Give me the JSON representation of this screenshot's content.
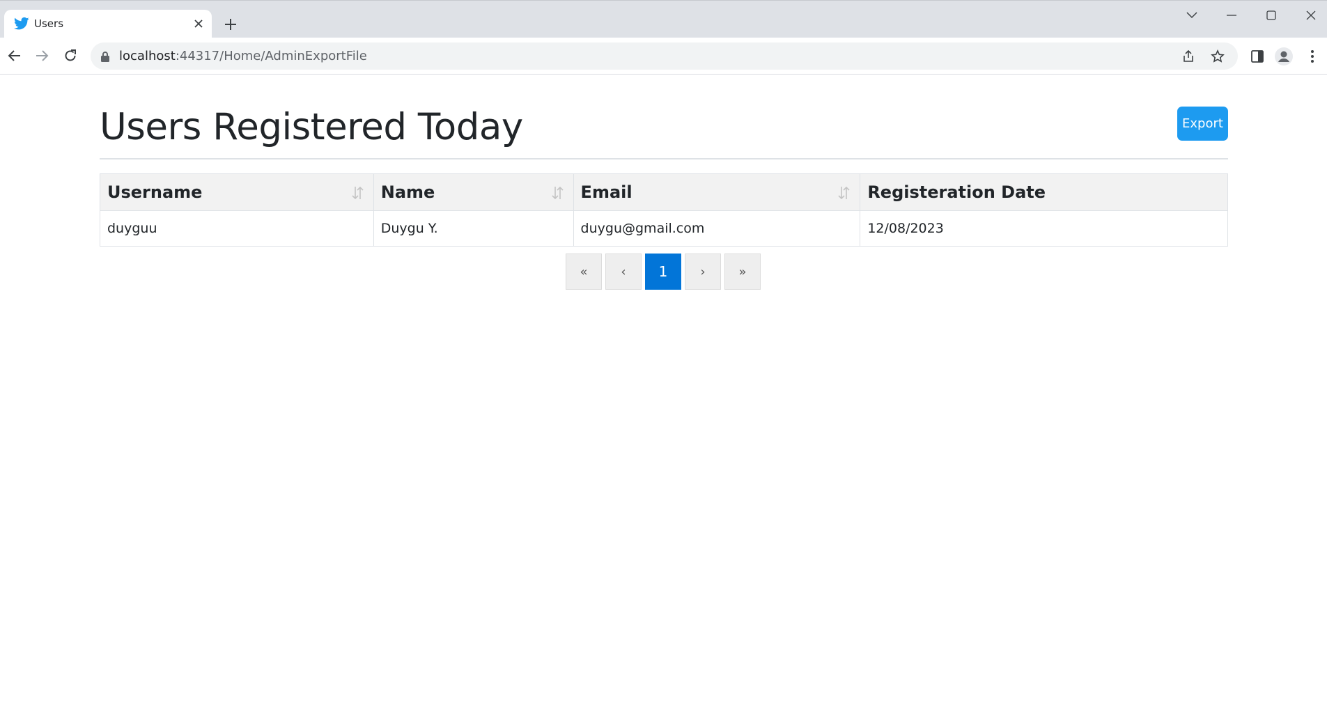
{
  "browser": {
    "tab_title": "Users",
    "url_host": "localhost",
    "url_rest": ":44317/Home/AdminExportFile",
    "icons": [
      "twitter-bird-icon",
      "close-icon",
      "plus-icon",
      "chevron-down-icon",
      "minimize-icon",
      "maximize-icon",
      "close-window-icon",
      "back-arrow-icon",
      "forward-arrow-icon",
      "reload-icon",
      "lock-icon",
      "share-icon",
      "star-icon",
      "sidebar-icon",
      "profile-icon",
      "kebab-menu-icon"
    ]
  },
  "page": {
    "title": "Users Registered Today",
    "export_label": "Export"
  },
  "table": {
    "columns": [
      {
        "label": "Username",
        "sortable": true
      },
      {
        "label": "Name",
        "sortable": true
      },
      {
        "label": "Email",
        "sortable": true
      },
      {
        "label": "Registeration Date",
        "sortable": false
      }
    ],
    "rows": [
      [
        "duyguu",
        "Duygu Y.",
        "duygu@gmail.com",
        "12/08/2023"
      ]
    ]
  },
  "pagination": {
    "first": "«",
    "prev": "‹",
    "current": "1",
    "next": "›",
    "last": "»"
  },
  "colors": {
    "accent": "#1d9bf0",
    "active_page": "#0275d8"
  }
}
